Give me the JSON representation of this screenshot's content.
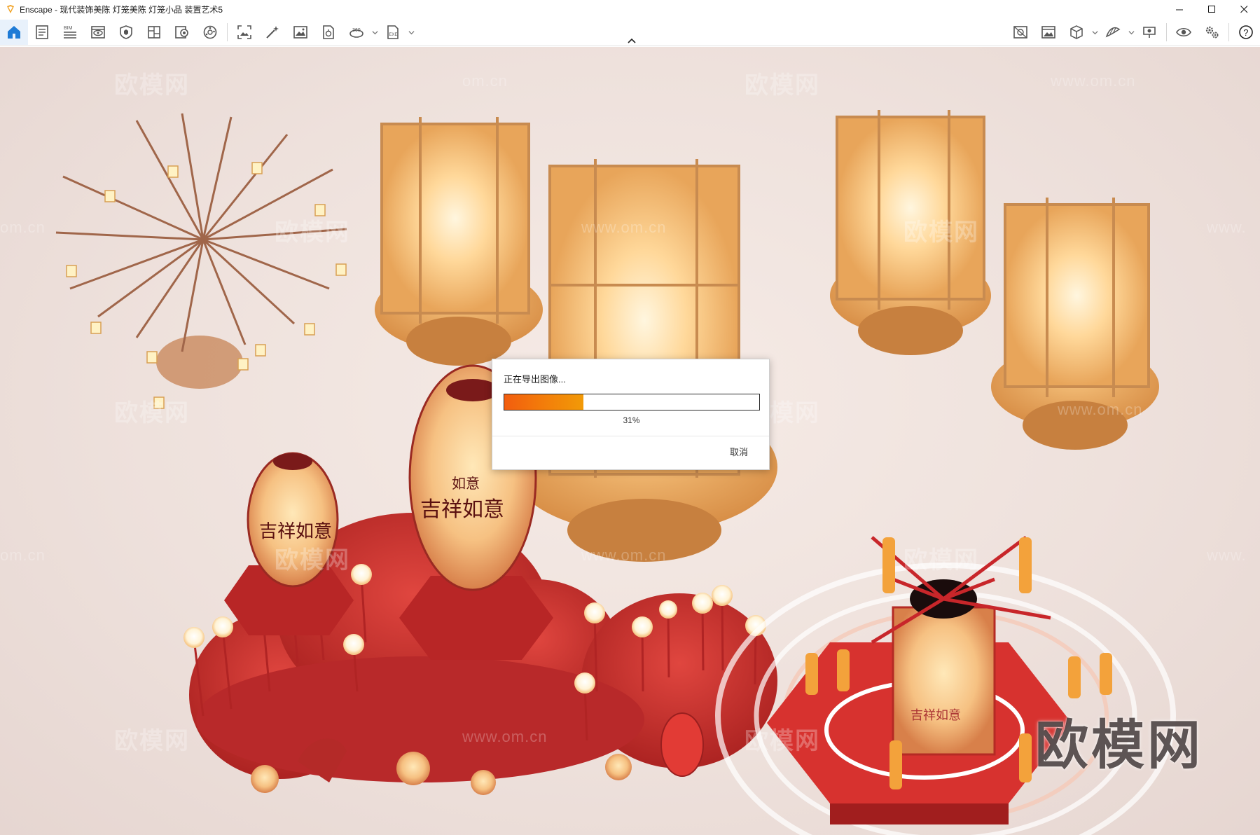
{
  "window": {
    "title": "Enscape - 现代装饰美陈 灯笼美陈 灯笼小品 装置艺术5",
    "controls": [
      "minimize",
      "maximize",
      "close"
    ]
  },
  "toolbar": {
    "left_icons": [
      "home-icon",
      "document-icon",
      "bim-icon",
      "visual-settings-icon",
      "asset-library-icon",
      "material-editor-icon",
      "views-icon",
      "atmosphere-icon",
      "screenshot-icon",
      "magic-wand-icon",
      "image-export-icon",
      "batch-export-icon",
      "panorama-360-icon",
      "exe-export-icon"
    ],
    "right_icons": [
      "vr-icon",
      "gallery-icon",
      "cube-icon",
      "mesh-icon",
      "presentation-icon",
      "eye-icon",
      "settings-icon",
      "help-icon"
    ],
    "bim_label": "BIM",
    "label_360": "360",
    "exe_label": "EXE",
    "help_label": "?"
  },
  "watermarks": {
    "brand": "欧模网",
    "url": "www.om.cn",
    "url_short": "om.cn",
    "url_prefix": "www."
  },
  "scene": {
    "lantern_texts": [
      "吉祥如意",
      "如意",
      "吉祥如意",
      "吉祥如意"
    ]
  },
  "dialog": {
    "title": "正在导出图像...",
    "progress_percent": 31,
    "progress_label": "31%",
    "cancel_label": "取消"
  },
  "colors": {
    "accent": "#1e7bd6",
    "progress_start": "#f25d0f",
    "progress_end": "#f29a07",
    "scene_red": "#c8322d",
    "lantern_glow": "#ffd79a"
  }
}
